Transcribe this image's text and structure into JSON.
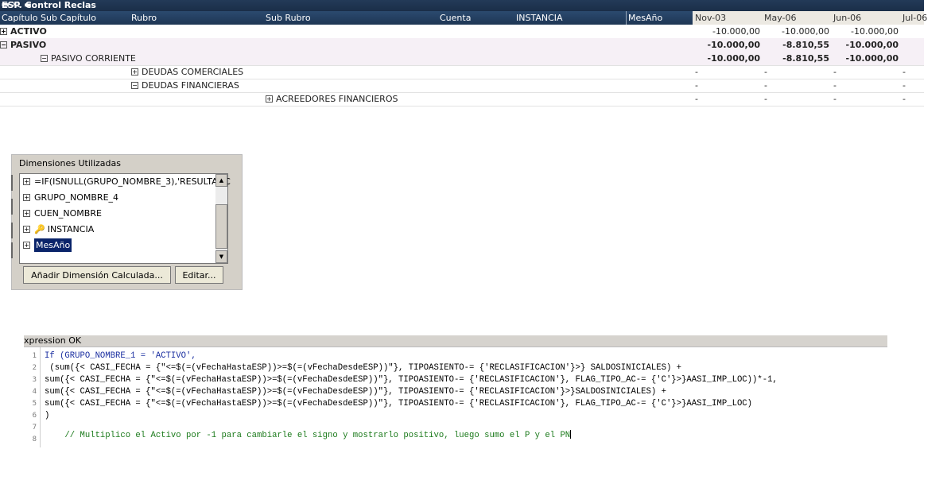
{
  "window": {
    "title": "ESP. Control Reclas",
    "title_icons": "🖶 XL ▬"
  },
  "table": {
    "headers": {
      "capitulo": "Capítulo",
      "sub_capitulo": "Sub Capítulo",
      "rubro": "Rubro",
      "sub_rubro": "Sub Rubro",
      "cuenta": "Cuenta",
      "instancia": "INSTANCIA",
      "mesanio": "MesAño"
    },
    "months": [
      "Nov-03",
      "May-06",
      "Jun-06",
      "Jul-06"
    ],
    "rows": [
      {
        "label": "ACTIVO",
        "icon": "plus-icon",
        "values": [
          "-10.000,00",
          "-10.000,00",
          "-10.000,00",
          ""
        ]
      },
      {
        "label": "PASIVO",
        "icon": "minus-icon",
        "values": [
          "-10.000,00",
          "-8.810,55",
          "-10.000,00",
          ""
        ]
      },
      {
        "label": "PASIVO CORRIENTE",
        "icon": "minus-icon",
        "values": [
          "-10.000,00",
          "-8.810,55",
          "-10.000,00",
          ""
        ]
      },
      {
        "label": "DEUDAS COMERCIALES",
        "icon": "plus-icon",
        "values": [
          "-",
          "-",
          "-",
          "-"
        ]
      },
      {
        "label": "DEUDAS FINANCIERAS",
        "icon": "minus-icon",
        "values": [
          "-",
          "-",
          "-",
          "-"
        ]
      },
      {
        "label": "ACREEDORES FINANCIEROS",
        "icon": "plus-icon",
        "values": [
          "-",
          "-",
          "-",
          "-"
        ]
      }
    ]
  },
  "dimensions_panel": {
    "title": "Dimensiones Utilizadas",
    "items": [
      {
        "label": "=IF(ISNULL(GRUPO_NOMBRE_3),'RESULTADC",
        "icon": "plus-icon"
      },
      {
        "label": "GRUPO_NOMBRE_4",
        "icon": "plus-icon"
      },
      {
        "label": "CUEN_NOMBRE",
        "icon": "plus-icon"
      },
      {
        "label": "INSTANCIA",
        "icon": "key-icon"
      },
      {
        "label": "MesAño",
        "icon": "plus-icon",
        "selected": true
      }
    ],
    "buttons": {
      "add": "Añadir Dimensión Calculada...",
      "edit": "Editar..."
    }
  },
  "expression": {
    "header": "xpression OK",
    "line_numbers": [
      "1",
      "2",
      "3",
      "4",
      "5",
      "6",
      "7",
      "8"
    ],
    "lines": [
      "If (GRUPO_NOMBRE_1 = 'ACTIVO',",
      " (sum({< CASI_FECHA = {\"<=$(=(vFechaHastaESP))>=$(=(vFechaDesdeESP))\"}, TIPOASIENTO-= {'RECLASIFICACION'}>} SALDOSINICIALES) +",
      "sum({< CASI_FECHA = {\"<=$(=(vFechaHastaESP))>=$(=(vFechaDesdeESP))\"}, TIPOASIENTO-= {'RECLASIFICACION'}, FLAG_TIPO_AC-= {'C'}>}AASI_IMP_LOC))*-1,",
      "sum({< CASI_FECHA = {\"<=$(=(vFechaHastaESP))>=$(=(vFechaDesdeESP))\"}, TIPOASIENTO-= {'RECLASIFICACION'}>}SALDOSINICIALES) +",
      "sum({< CASI_FECHA = {\"<=$(=(vFechaHastaESP))>=$(=(vFechaDesdeESP))\"}, TIPOASIENTO-= {'RECLASIFICACION'}, FLAG_TIPO_AC-= {'C'}>}AASI_IMP_LOC)",
      ")",
      "",
      "    // Multiplico el Activo por -1 para cambiarle el signo y mostrarlo positivo, luego sumo el P y el PN"
    ]
  },
  "colors": {
    "header_bg": "#1e3654",
    "selection": "#0a246a",
    "comment": "#1b7a1b",
    "keyword": "#1a2ea0"
  }
}
